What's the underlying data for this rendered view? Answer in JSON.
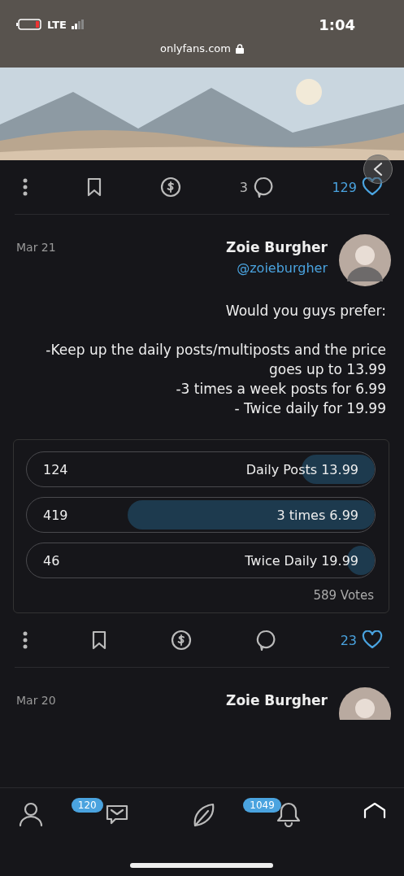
{
  "status_bar": {
    "time": "1:04",
    "network": "LTE"
  },
  "address_bar": {
    "url": "onlyfans.com"
  },
  "posts": [
    {
      "kind": "media",
      "actions": {
        "liked": true,
        "likes": "129",
        "comments": "3"
      }
    },
    {
      "kind": "poll",
      "author": "Zoie Burgher",
      "handle": "@zoieburgher",
      "date": "Mar 21",
      "text_paragraphs": [
        [
          "Would you guys prefer:"
        ],
        [
          "-Keep up the daily posts/multiposts and the price goes up to 13.99",
          "-3 times a week posts for 6.99",
          "- Twice daily for 19.99"
        ]
      ],
      "poll": {
        "options": [
          {
            "label": "Daily Posts 13.99",
            "count": "124",
            "level": 0.21
          },
          {
            "label": "3 times 6.99",
            "count": "419",
            "level": 0.71
          },
          {
            "label": "Twice Daily 19.99",
            "count": "46",
            "level": 0.08
          }
        ],
        "total": "589 Votes"
      },
      "actions": {
        "liked": true,
        "likes": "23"
      }
    },
    {
      "kind": "header",
      "author": "Zoie Burgher",
      "date": "Mar 20"
    }
  ],
  "bottom_nav": [
    {
      "kind": "profile"
    },
    {
      "kind": "messages",
      "badge": "120"
    },
    {
      "kind": "explore"
    },
    {
      "kind": "notifications",
      "badge": "1049"
    },
    {
      "kind": "home"
    }
  ]
}
